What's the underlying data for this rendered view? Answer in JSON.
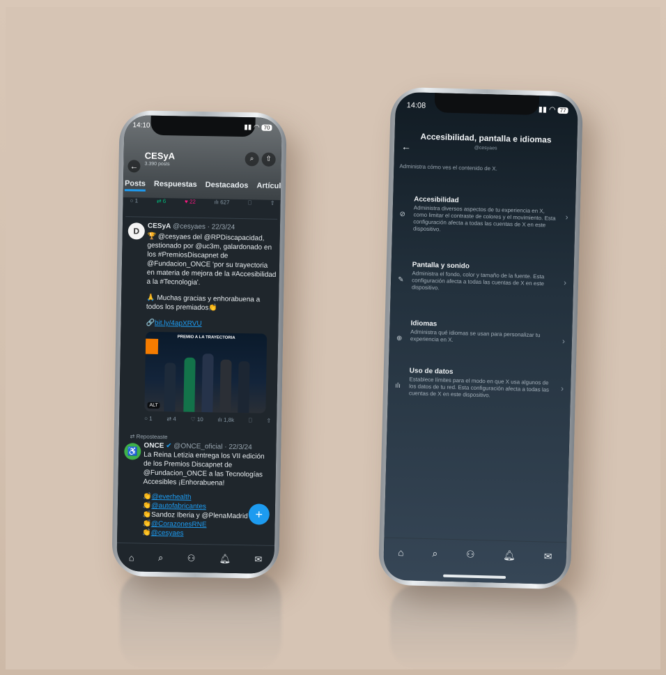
{
  "left_phone": {
    "status": {
      "time": "14:10",
      "battery": "70"
    },
    "profile": {
      "name": "CESyA",
      "posts_count": "3.390 posts"
    },
    "tabs": [
      "Posts",
      "Respuestas",
      "Destacados",
      "Artículos"
    ],
    "top_actions": {
      "replies": "1",
      "reposts": "6",
      "likes": "22",
      "views": "627"
    },
    "post": {
      "author": "CESyA",
      "handle": "@cesyaes",
      "date": "· 22/3/24",
      "text1": "🏆 @cesyaes del @RPDiscapacidad, gestionado por @uc3m, galardonado en los #PremiosDiscapnet de @Fundacion_ONCE 'por su trayectoria en materia de mejora de la #Accesibilidad a la #Tecnologia'.",
      "text2": "🙏 Muchas gracias y enhorabuena a todos los premiados👏",
      "link": "bit.ly/4apXRVU",
      "image_banner": "PREMIO A LA TRAYECTORIA",
      "image_alt": "ALT",
      "actions": {
        "replies": "1",
        "reposts": "4",
        "likes": "10",
        "views": "1,8k"
      }
    },
    "repost": {
      "label": "Reposteaste",
      "author": "ONCE",
      "handle": "@ONCE_oficial",
      "date": "· 22/3/24",
      "text": "La Reina Letizia entrega los VII edición de los Premios Discapnet de @Fundacion_ONCE a las Tecnologías Accesibles ¡Enhorabuena!",
      "mentions": [
        "@everhealth",
        "@autofabricantes",
        "Sandoz Iberia y @PlenaMadrid",
        "@CorazonesRNE",
        "@cesyaes"
      ]
    },
    "fab": "+"
  },
  "right_phone": {
    "status": {
      "time": "14:08",
      "battery": "77"
    },
    "title": "Accesibilidad, pantalla e idiomas",
    "handle": "@cesyaes",
    "intro": "Administra cómo ves el contenido de X.",
    "items": [
      {
        "icon": "accessibility-icon",
        "title": "Accesibilidad",
        "desc": "Administra diversos aspectos de tu experiencia en X, como limitar el contraste de colores y el movimiento. Esta configuración afecta a todas las cuentas de X en este dispositivo."
      },
      {
        "icon": "brush-icon",
        "title": "Pantalla y sonido",
        "desc": "Administra el fondo, color y tamaño de la fuente. Esta configuración afecta a todas las cuentas de X en este dispositivo."
      },
      {
        "icon": "globe-icon",
        "title": "Idiomas",
        "desc": "Administra qué idiomas se usan para personalizar tu experiencia en X."
      },
      {
        "icon": "bar-chart-icon",
        "title": "Uso de datos",
        "desc": "Establece límites para el modo en que X usa algunos de los datos de tu red. Esta configuración afecta a todas las cuentas de X en este dispositivo."
      }
    ]
  },
  "colors": {
    "accent": "#1d9bf0",
    "like": "#f91880",
    "repost": "#00ba7c"
  }
}
